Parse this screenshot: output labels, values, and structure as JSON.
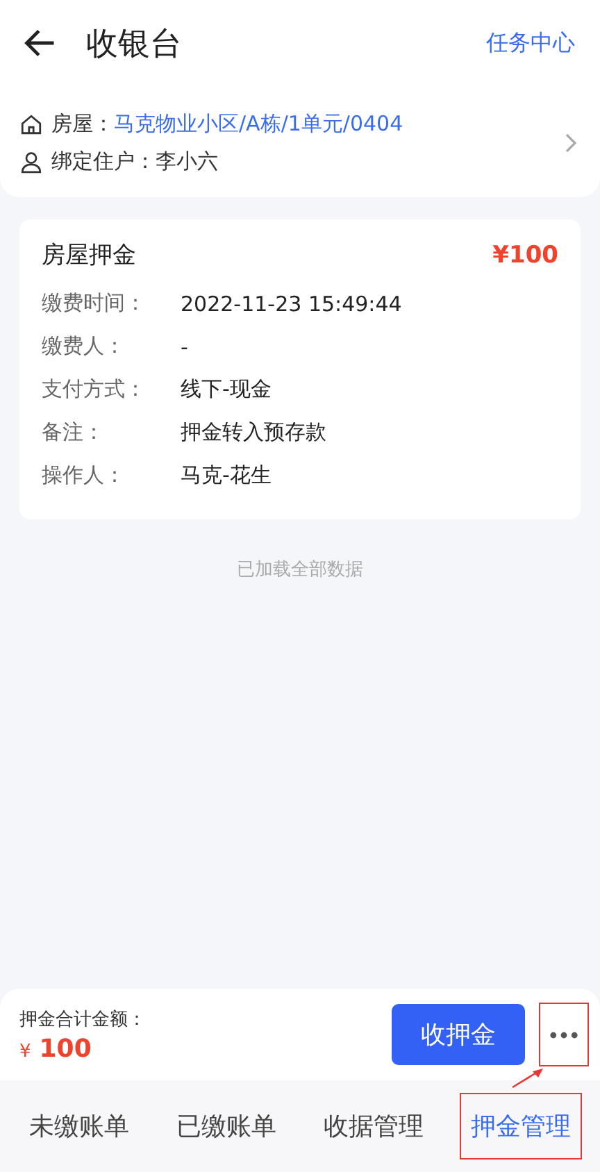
{
  "header": {
    "title": "收银台",
    "action": "任务中心"
  },
  "house": {
    "rows": [
      {
        "kind": "house",
        "label": "房屋：",
        "value": "马克物业小区/A栋/1单元/0404"
      },
      {
        "kind": "person",
        "label": "绑定住户：",
        "value": "李小六"
      }
    ]
  },
  "records": [
    {
      "title": "房屋押金",
      "amount": "¥100",
      "fields": [
        {
          "label": "缴费时间：",
          "value": "2022-11-23 15:49:44"
        },
        {
          "label": "缴费人：",
          "value": "-"
        },
        {
          "label": "支付方式：",
          "value": "线下-现金"
        },
        {
          "label": "备注：",
          "value": "押金转入预存款"
        },
        {
          "label": "操作人：",
          "value": "马克-花生"
        }
      ]
    }
  ],
  "list_end": "已加载全部数据",
  "footer": {
    "total_label": "押金合计金额：",
    "currency": "¥",
    "total": "100",
    "primary_button": "收押金",
    "more_highlighted": true
  },
  "tabs": [
    {
      "label": "未缴账单",
      "selected": false,
      "highlighted": false
    },
    {
      "label": "已缴账单",
      "selected": false,
      "highlighted": false
    },
    {
      "label": "收据管理",
      "selected": false,
      "highlighted": false
    },
    {
      "label": "押金管理",
      "selected": true,
      "highlighted": true
    }
  ]
}
